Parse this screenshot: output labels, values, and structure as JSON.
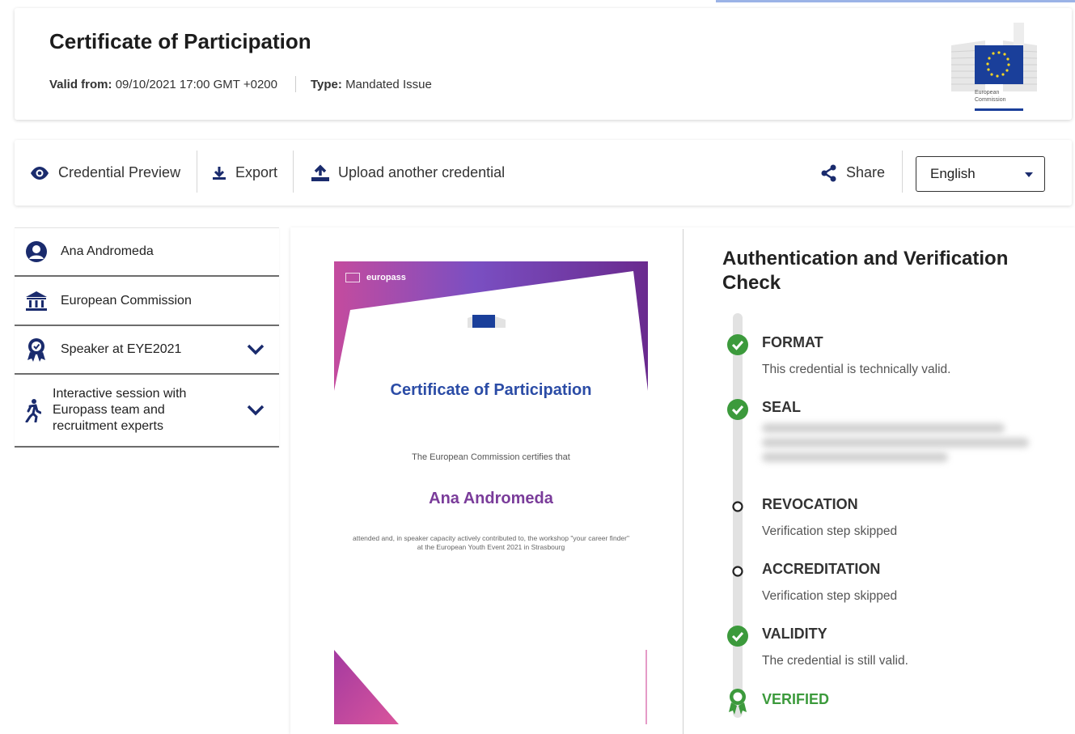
{
  "header": {
    "title": "Certificate of Participation",
    "valid_from_label": "Valid from:",
    "valid_from_value": "09/10/2021 17:00 GMT +0200",
    "type_label": "Type:",
    "type_value": "Mandated Issue",
    "logo_text_1": "European",
    "logo_text_2": "Commission"
  },
  "toolbar": {
    "preview_label": "Credential Preview",
    "export_label": "Export",
    "upload_label": "Upload another credential",
    "share_label": "Share",
    "language": "English"
  },
  "sidebar": {
    "items": [
      {
        "label": "Ana Andromeda",
        "icon": "person-icon"
      },
      {
        "label": "European Commission",
        "icon": "institution-icon"
      },
      {
        "label": "Speaker at EYE2021",
        "icon": "award-icon",
        "expandable": true
      },
      {
        "label": "Interactive session with Europass team and recruitment experts",
        "icon": "activity-icon",
        "expandable": true
      }
    ]
  },
  "certificate": {
    "brand": "europass",
    "title": "Certificate of Participation",
    "certifies": "The European Commission certifies that",
    "name": "Ana Andromeda",
    "description": "attended and, in speaker capacity actively contributed to, the workshop \"your career finder\" at the European Youth Event 2021 in Strasbourg"
  },
  "verification": {
    "title": "Authentication and Verification Check",
    "steps": [
      {
        "name": "FORMAT",
        "desc": "This credential is technically valid.",
        "status": "passed"
      },
      {
        "name": "SEAL",
        "desc": "",
        "status": "passed",
        "blurred": true
      },
      {
        "name": "REVOCATION",
        "desc": "Verification step skipped",
        "status": "skipped"
      },
      {
        "name": "ACCREDITATION",
        "desc": "Verification step skipped",
        "status": "skipped"
      },
      {
        "name": "VALIDITY",
        "desc": "The credential is still valid.",
        "status": "passed"
      },
      {
        "name": "VERIFIED",
        "desc": "",
        "status": "verified"
      }
    ]
  },
  "colors": {
    "brand_blue": "#1a2b6d",
    "success_green": "#3c9a3c",
    "cert_title_blue": "#2b4ca6",
    "cert_name_purple": "#7a3c9a"
  }
}
